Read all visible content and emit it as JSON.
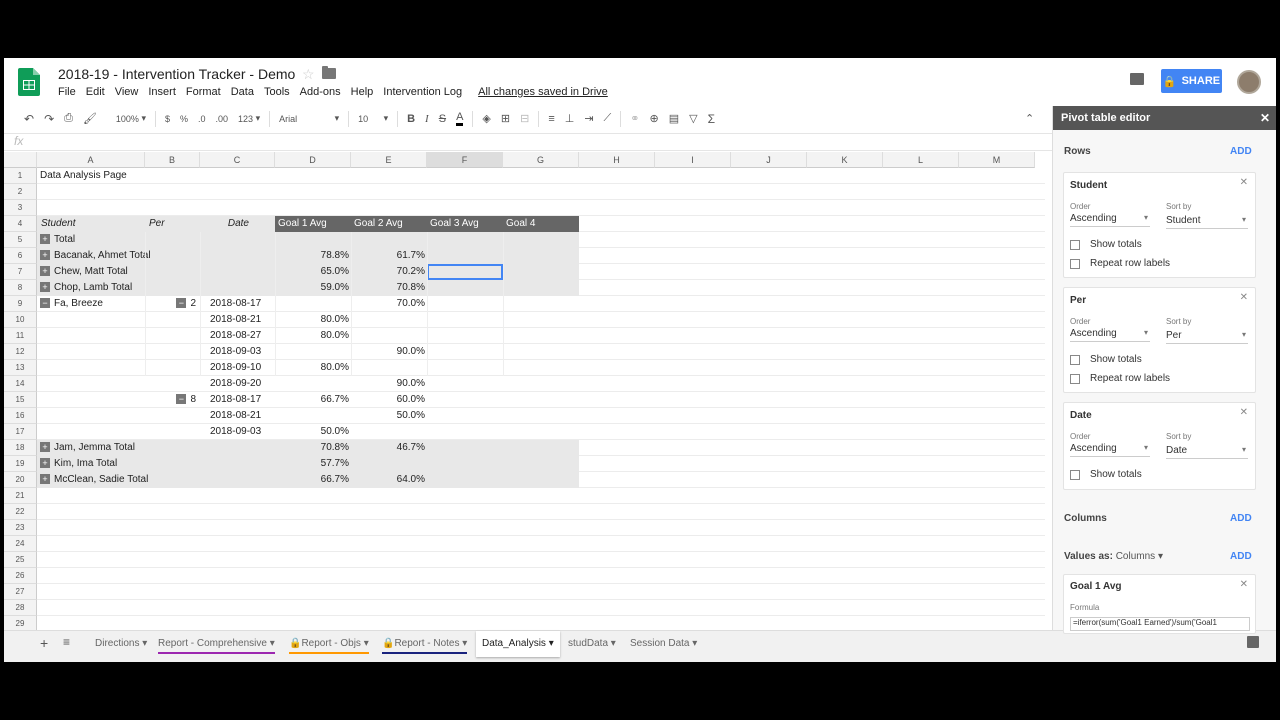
{
  "header": {
    "title": "2018-19 - Intervention Tracker - Demo",
    "share": "SHARE",
    "saved": "All changes saved in Drive"
  },
  "menu": [
    "File",
    "Edit",
    "View",
    "Insert",
    "Format",
    "Data",
    "Tools",
    "Add-ons",
    "Help",
    "Intervention Log"
  ],
  "toolbar": {
    "zoom": "100%",
    "currency": "$",
    "percent": "%",
    "dec_less": ".0",
    "dec_more": ".00",
    "format": "123",
    "font": "Arial",
    "size": "10",
    "bold": "B",
    "italic": "I",
    "strike": "S",
    "text_color": "A",
    "sigma": "Σ"
  },
  "formula_bar": {
    "fx": "fx"
  },
  "columns": [
    "A",
    "B",
    "C",
    "D",
    "E",
    "F",
    "G",
    "H",
    "I",
    "J",
    "K",
    "L",
    "M"
  ],
  "rows": [
    "1",
    "2",
    "3",
    "4",
    "5",
    "6",
    "7",
    "8",
    "9",
    "10",
    "11",
    "12",
    "13",
    "14",
    "15",
    "16",
    "17",
    "18",
    "19",
    "20",
    "21",
    "22",
    "23",
    "24",
    "25",
    "26",
    "27",
    "28",
    "29"
  ],
  "sheet": {
    "title": "Data Analysis Page",
    "headers": [
      "Student",
      "Per",
      "Date",
      "Goal 1 Avg",
      "Goal 2 Avg",
      "Goal 3 Avg",
      "Goal 4"
    ],
    "total": "Total",
    "summary": [
      {
        "name": "Bacanak, Ahmet Total",
        "g1": "78.8%",
        "g2": "61.7%"
      },
      {
        "name": "Chew, Matt Total",
        "g1": "65.0%",
        "g2": "70.2%"
      },
      {
        "name": "Chop, Lamb Total",
        "g1": "59.0%",
        "g2": "70.8%"
      }
    ],
    "fa": {
      "name": "Fa, Breeze",
      "detail": [
        {
          "per": "2",
          "date": "2018-08-17",
          "g1": "",
          "g2": "70.0%"
        },
        {
          "per": "",
          "date": "2018-08-21",
          "g1": "80.0%",
          "g2": ""
        },
        {
          "per": "",
          "date": "2018-08-27",
          "g1": "80.0%",
          "g2": ""
        },
        {
          "per": "",
          "date": "2018-09-03",
          "g1": "",
          "g2": "90.0%"
        },
        {
          "per": "",
          "date": "2018-09-10",
          "g1": "80.0%",
          "g2": ""
        },
        {
          "per": "",
          "date": "2018-09-20",
          "g1": "",
          "g2": "90.0%"
        },
        {
          "per": "8",
          "date": "2018-08-17",
          "g1": "66.7%",
          "g2": "60.0%"
        },
        {
          "per": "",
          "date": "2018-08-21",
          "g1": "",
          "g2": "50.0%"
        },
        {
          "per": "",
          "date": "2018-09-03",
          "g1": "50.0%",
          "g2": ""
        }
      ]
    },
    "summary2": [
      {
        "name": "Jam, Jemma Total",
        "g1": "70.8%",
        "g2": "46.7%"
      },
      {
        "name": "Kim, Ima Total",
        "g1": "57.7%",
        "g2": ""
      },
      {
        "name": "McClean, Sadie Total",
        "g1": "66.7%",
        "g2": "64.0%"
      }
    ]
  },
  "tabs": [
    "Directions",
    "Report - Comprehensive",
    "Report - Objs",
    "Report - Notes",
    "Data_Analysis",
    "studData",
    "Session Data"
  ],
  "panel": {
    "title": "Pivot table editor",
    "rows_label": "Rows",
    "add": "ADD",
    "order_label": "Order",
    "sortby_label": "Sort by",
    "ascending": "Ascending",
    "show_totals": "Show totals",
    "repeat": "Repeat row labels",
    "fields": [
      {
        "name": "Student",
        "sort": "Student"
      },
      {
        "name": "Per",
        "sort": "Per"
      },
      {
        "name": "Date",
        "sort": "Date"
      }
    ],
    "columns_label": "Columns",
    "values_label": "Values as:",
    "values_mode": "Columns",
    "value_field": "Goal 1 Avg",
    "formula_label": "Formula",
    "formula": "=iferror(sum('Goal1 Earned')/sum('Goal1"
  }
}
